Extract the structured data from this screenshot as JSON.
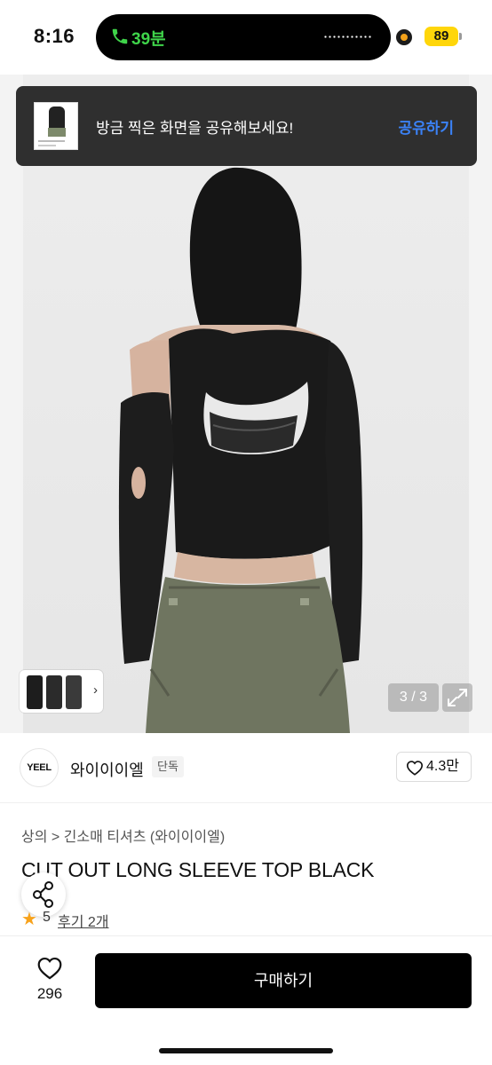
{
  "status_bar": {
    "time": "8:16",
    "call_duration": "39분",
    "battery": "89"
  },
  "toast": {
    "message": "방금 찍은 화면을 공유해보세요!",
    "action": "공유하기"
  },
  "gallery": {
    "counter": "3 / 3",
    "thumbnail_chevron": "›"
  },
  "brand": {
    "logo_text": "YEEL",
    "name": "와이이이엘",
    "badge": "단독",
    "likes": "4.3만"
  },
  "product": {
    "breadcrumb": "상의 > 긴소매 티셔츠 (와이이이엘)",
    "title": "CUT OUT LONG SLEEVE TOP BLACK",
    "rating": "5",
    "reviews": "후기 2개"
  },
  "bottom_bar": {
    "heart_count": "296",
    "buy_label": "구매하기"
  },
  "colors": {
    "call_green": "#3fd44a",
    "toast_action_blue": "#3b82f6",
    "star_orange": "#f7a21b",
    "battery_yellow": "#ffd60a"
  }
}
